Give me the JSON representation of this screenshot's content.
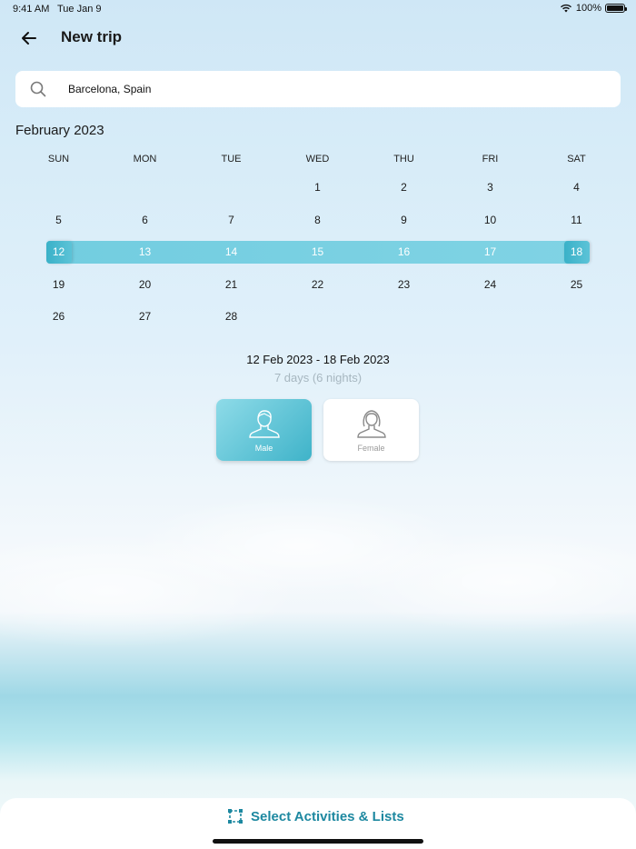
{
  "status_bar": {
    "time": "9:41 AM",
    "date": "Tue Jan 9",
    "battery": "100%"
  },
  "header": {
    "title": "New trip",
    "back_icon": "arrow-left-icon"
  },
  "search": {
    "value": "Barcelona, Spain",
    "icon": "search-icon"
  },
  "calendar": {
    "month_title": "February 2023",
    "weekdays": [
      "SUN",
      "MON",
      "TUE",
      "WED",
      "THU",
      "FRI",
      "SAT"
    ],
    "weeks": [
      [
        "",
        "",
        "",
        "1",
        "2",
        "3",
        "4"
      ],
      [
        "5",
        "6",
        "7",
        "8",
        "9",
        "10",
        "11"
      ],
      [
        "12",
        "13",
        "14",
        "15",
        "16",
        "17",
        "18"
      ],
      [
        "19",
        "20",
        "21",
        "22",
        "23",
        "24",
        "25"
      ],
      [
        "26",
        "27",
        "28",
        "",
        "",
        "",
        ""
      ]
    ],
    "range_start": 12,
    "range_end": 18,
    "range_color": "#72cde0"
  },
  "summary": {
    "date_range": "12 Feb 2023 - 18 Feb 2023",
    "duration": "7 days (6 nights)"
  },
  "gender": {
    "male_label": "Male",
    "female_label": "Female",
    "selected": "Male"
  },
  "footer": {
    "action_label": "Select Activities & Lists",
    "action_icon": "selection-frame-icon",
    "accent_color": "#1d88a0"
  }
}
